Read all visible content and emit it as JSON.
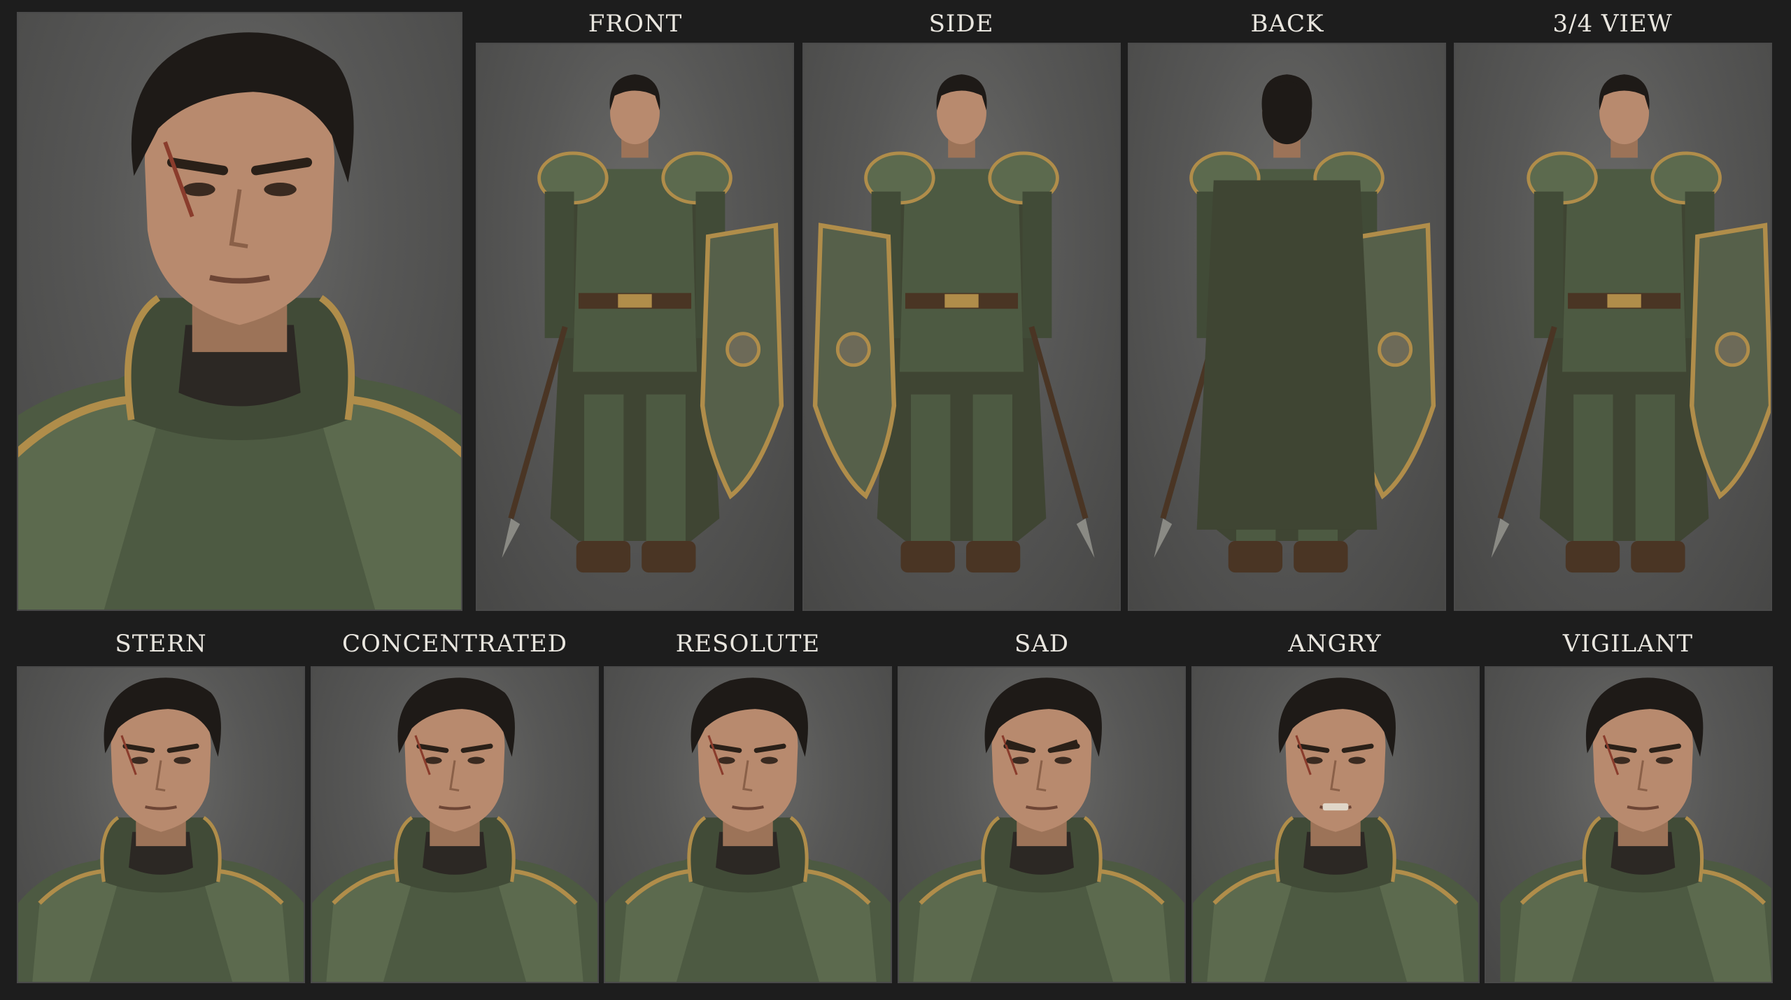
{
  "views": {
    "labels": [
      "FRONT",
      "SIDE",
      "BACK",
      "3/4 VIEW"
    ]
  },
  "expressions": {
    "labels": [
      "STERN",
      "CONCENTRATED",
      "RESOLUTE",
      "SAD",
      "ANGRY",
      "VIGILANT"
    ]
  },
  "colors": {
    "background": "#1d1d1d",
    "panel": "#575756",
    "panel_border": "#4a4a4a",
    "label_text": "#e9e6df",
    "armor_green": "#4d5a42",
    "armor_trim_gold": "#b08d4a",
    "leather": "#4a3524",
    "skin": "#b88a6e",
    "hair": "#1e1a17",
    "cape": "#3f4533"
  }
}
